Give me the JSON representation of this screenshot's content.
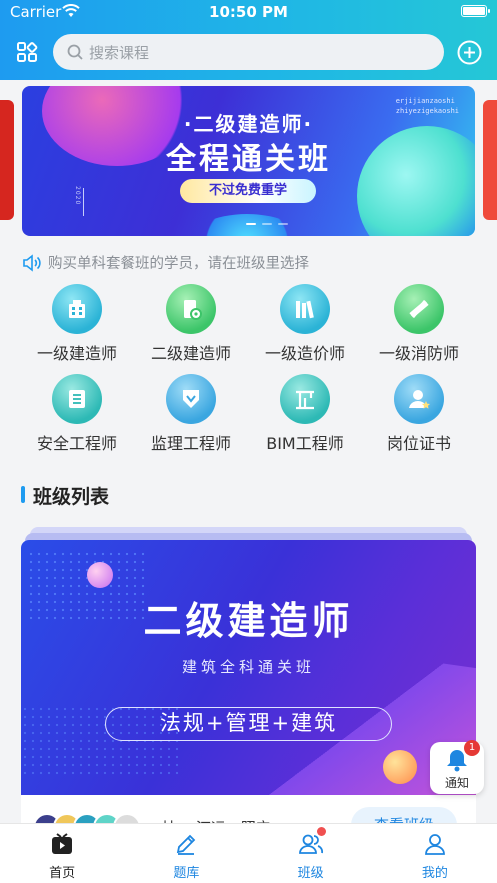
{
  "status_bar": {
    "carrier": "Carrier",
    "time": "10:50 PM"
  },
  "search": {
    "placeholder": "搜索课程"
  },
  "banner": {
    "title_small": "·二级建造师·",
    "title_large": "全程通关班",
    "pill": "不过免费重学",
    "corner_text": [
      "erjijianzaoshi",
      "zhiyezigekaoshi"
    ],
    "vertical_text": "2020"
  },
  "notice": {
    "text": "购买单科套餐班的学员，请在班级里选择"
  },
  "categories": [
    {
      "label": "一级建造师",
      "icon": "building-icon",
      "color": "#2bb3d6"
    },
    {
      "label": "二级建造师",
      "icon": "gear-document-icon",
      "color": "#3cc569"
    },
    {
      "label": "一级造价师",
      "icon": "books-icon",
      "color": "#2bb3d6"
    },
    {
      "label": "一级消防师",
      "icon": "ruler-pencil-icon",
      "color": "#3cc569"
    },
    {
      "label": "安全工程师",
      "icon": "book-icon",
      "color": "#2db9b5"
    },
    {
      "label": "监理工程师",
      "icon": "shield-down-icon",
      "color": "#3aa6e0"
    },
    {
      "label": "BIM工程师",
      "icon": "crane-icon",
      "color": "#2db9b5"
    },
    {
      "label": "岗位证书",
      "icon": "person-star-icon",
      "color": "#3aa6e0"
    }
  ],
  "section": {
    "title": "班级列表"
  },
  "class_card": {
    "title": "二级建造师",
    "subtitle": "建筑全科通关班",
    "subjects": "法规+管理+建筑",
    "teachers_text": "林…  汀运、照宁…",
    "button": "查看班级"
  },
  "notify": {
    "label": "通知",
    "count": "1"
  },
  "tabs": [
    {
      "label": "首页",
      "icon": "tv-icon",
      "active": true
    },
    {
      "label": "题库",
      "icon": "pencil-icon",
      "active": false
    },
    {
      "label": "班级",
      "icon": "people-icon",
      "active": false
    },
    {
      "label": "我的",
      "icon": "user-icon",
      "active": false
    }
  ],
  "colors": {
    "accent": "#1e9bf0",
    "header_gradient_end": "#25c7d6",
    "badge": "#e53935"
  }
}
